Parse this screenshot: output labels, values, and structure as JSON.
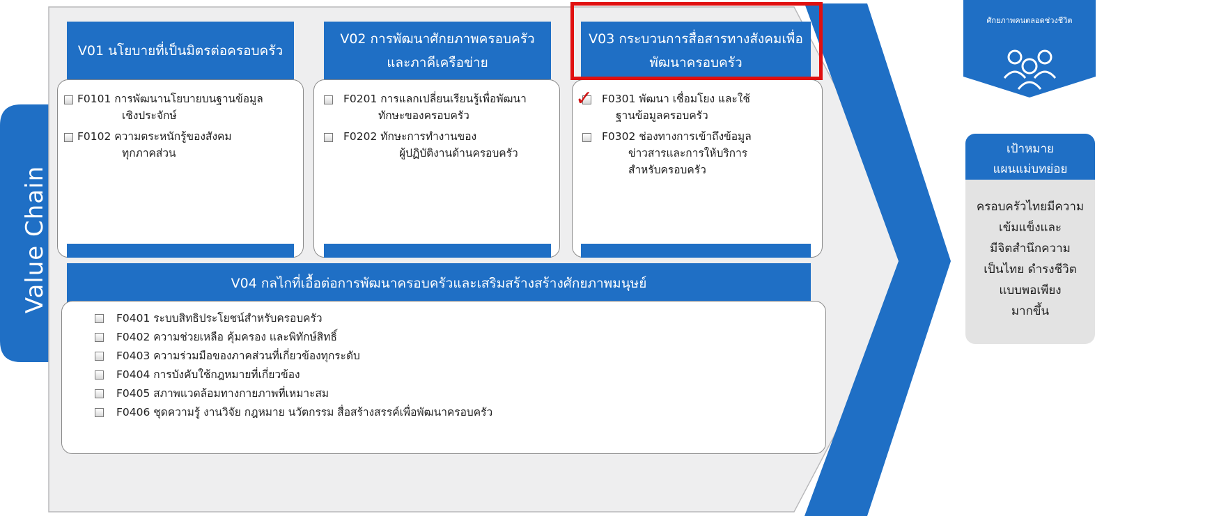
{
  "value_chain_label": "Value Chain",
  "columns": [
    {
      "header_lines": [
        "V01 นโยบายที่เป็นมิตรต่อครอบครัว"
      ],
      "items": [
        {
          "lines": [
            "F0101 การพัฒนานโยบายบนฐานข้อมูล",
            "เชิงประจักษ์"
          ],
          "checked": false
        },
        {
          "lines": [
            "F0102 ความตระหนักรู้ของสังคม",
            "ทุกภาคส่วน"
          ],
          "checked": false
        }
      ]
    },
    {
      "header_lines": [
        "V02 การพัฒนาศักยภาพครอบครัว",
        "และภาคีเครือข่าย"
      ],
      "items": [
        {
          "lines": [
            "F0201 การแลกเปลี่ยนเรียนรู้เพื่อพัฒนา",
            "ทักษะของครอบครัว"
          ],
          "checked": false
        },
        {
          "lines": [
            "F0202 ทักษะการทำงานของ",
            "ผู้ปฏิบัติงานด้านครอบครัว"
          ],
          "checked": false
        }
      ]
    },
    {
      "header_lines": [
        "V03 กระบวนการสื่อสารทางสังคมเพื่อ",
        "พัฒนาครอบครัว"
      ],
      "items": [
        {
          "lines": [
            "F0301 พัฒนา เชื่อมโยง และใช้",
            "ฐานข้อมูลครอบครัว"
          ],
          "checked": true
        },
        {
          "lines": [
            "F0302 ช่องทางการเข้าถึงข้อมูล",
            "ข่าวสารและการให้บริการ",
            "สำหรับครอบครัว"
          ],
          "checked": false
        }
      ]
    }
  ],
  "bottom": {
    "header": "V04 กลไกที่เอื้อต่อการพัฒนาครอบครัวและเสริมสร้างสร้างศักยภาพมนุษย์",
    "items": [
      "F0401 ระบบสิทธิประโยชน์สำหรับครอบครัว",
      "F0402 ความช่วยเหลือ คุ้มครอง และพิทักษ์สิทธิ์",
      "F0403 ความร่วมมือของภาคส่วนที่เกี่ยวข้องทุกระดับ",
      "F0404 การบังคับใช้กฎหมายที่เกี่ยวข้อง",
      "F0405 สภาพแวดล้อมทางกายภาพที่เหมาะสม",
      "F0406 ชุดความรู้ งานวิจัย กฎหมาย นวัตกรรม สื่อสร้างสรรค์เพื่อพัฒนาครอบครัว"
    ]
  },
  "hexagon_text": "ศักยภาพคนตลอดช่วงชีวิต",
  "goal": {
    "title_lines": [
      "เป้าหมาย",
      "แผนแม่บทย่อย"
    ],
    "body_lines": [
      "ครอบครัวไทยมีความ",
      "เข้มแข็งและ",
      "มีจิตสำนึกความ",
      "เป็นไทย ดำรงชีวิต",
      "แบบพอเพียง",
      "มากขึ้น"
    ]
  },
  "colors": {
    "primary": "#1f6fc5",
    "highlight": "#e01010",
    "panel": "#eeeeef"
  },
  "icons": [
    "people-icon",
    "checkbox-icon",
    "checkmark-icon"
  ]
}
